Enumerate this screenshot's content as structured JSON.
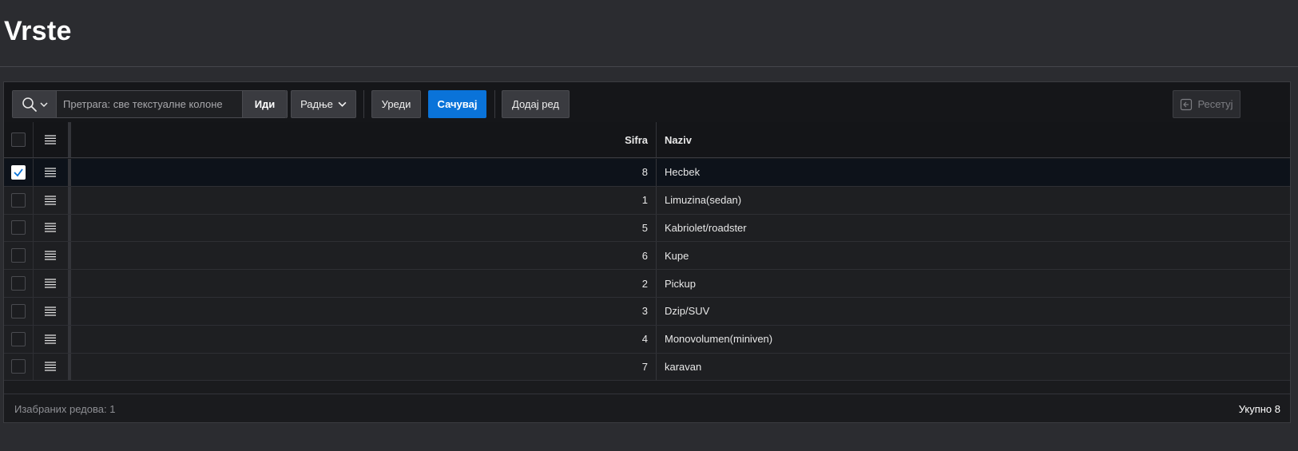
{
  "page": {
    "title": "Vrste"
  },
  "toolbar": {
    "search_icon": "search-icon",
    "search_placeholder": "Претрага: све текстуалне колоне",
    "go_label": "Иди",
    "actions_label": "Радње",
    "edit_label": "Уреди",
    "save_label": "Сачувај",
    "add_row_label": "Додај ред",
    "reset_label": "Ресетуј"
  },
  "grid": {
    "columns": {
      "sifra": "Sifra",
      "naziv": "Naziv"
    },
    "rows": [
      {
        "sifra": "8",
        "naziv": "Hecbek",
        "selected": true
      },
      {
        "sifra": "1",
        "naziv": "Limuzina(sedan)",
        "selected": false
      },
      {
        "sifra": "5",
        "naziv": "Kabriolet/roadster",
        "selected": false
      },
      {
        "sifra": "6",
        "naziv": "Kupe",
        "selected": false
      },
      {
        "sifra": "2",
        "naziv": "Pickup",
        "selected": false
      },
      {
        "sifra": "3",
        "naziv": "Dzip/SUV",
        "selected": false
      },
      {
        "sifra": "4",
        "naziv": "Monovolumen(miniven)",
        "selected": false
      },
      {
        "sifra": "7",
        "naziv": "karavan",
        "selected": false
      }
    ]
  },
  "footer": {
    "selected_rows": "Изабраних редова: 1",
    "total": "Укупно 8"
  },
  "colors": {
    "accent": "#0a73d9",
    "background": "#2b2c30",
    "selected_row": "#0d121a"
  }
}
